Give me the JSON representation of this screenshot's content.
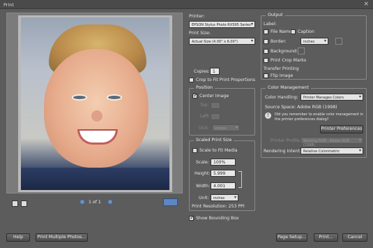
{
  "window": {
    "title": "Print",
    "close_label": "×"
  },
  "preview": {
    "page_indicator": "1 of 1"
  },
  "printer": {
    "label": "Printer:",
    "value": "EPSON Stylus Photo RX595 Series"
  },
  "print_size": {
    "label": "Print Size:",
    "value": "Actual Size (4.00\" x 6.00\")"
  },
  "copies": {
    "label": "Copies:",
    "value": "1"
  },
  "crop_to_fit": {
    "label": "Crop to Fit Print Proportions",
    "checked": false
  },
  "position": {
    "legend": "Position",
    "center_image": "Center Image",
    "top_label": "Top:",
    "top_value": "",
    "left_label": "Left:",
    "left_value": "",
    "unit_label": "Unit:",
    "unit_value": "inches"
  },
  "scaled": {
    "legend": "Scaled Print Size",
    "scale_to_fit": "Scale to Fit Media",
    "scale_label": "Scale:",
    "scale_value": "100%",
    "height_label": "Height:",
    "height_value": "5.999",
    "width_label": "Width:",
    "width_value": "4.001",
    "unit_label": "Unit:",
    "unit_value": "inches",
    "resolution": "Print Resolution: 253 PPI"
  },
  "show_bounding_box": "Show Bounding Box",
  "output": {
    "legend": "Output",
    "label_heading": "Label:",
    "file_name": "File Name",
    "caption": "Caption",
    "border": "Border:",
    "border_unit": "inches",
    "background": "Background:",
    "print_crop_marks": "Print Crop Marks",
    "transfer_printing": "Transfer Printing",
    "flip_image": "Flip Image"
  },
  "color_management": {
    "legend": "Color Management",
    "handling_label": "Color Handling:",
    "handling_value": "Printer Manages Colors",
    "source_space": "Source Space:  Adobe RGB (1998)",
    "reminder": "Did you remember to enable color management in the printer preferences dialog?",
    "printer_prefs": "Printer Preferences",
    "printer_profile_label": "Printer Profile:",
    "printer_profile_value": "Working RGB - Adobe RGB (1998)",
    "rendering_label": "Rendering Intent:",
    "rendering_value": "Relative Colorimetric"
  },
  "footer": {
    "help": "Help",
    "print_multiple": "Print Multiple Photos...",
    "page_setup": "Page Setup...",
    "print": "Print...",
    "cancel": "Cancel"
  }
}
